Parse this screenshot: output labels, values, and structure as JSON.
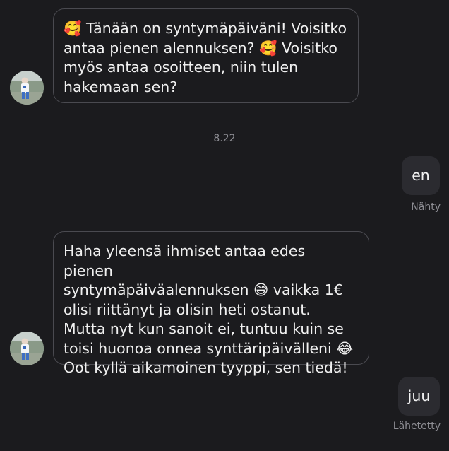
{
  "conversation": {
    "messages": [
      {
        "direction": "incoming",
        "text": "🥰 Tänään on syntymäpäiväni! Voisitko\nantaa pienen alennuksen? 🥰 Voisitko\nmyös antaa osoitteen, niin tulen\nhakemaan sen?"
      },
      {
        "direction": "timestamp",
        "text": "8.22"
      },
      {
        "direction": "outgoing",
        "text": "en",
        "status": "Nähty"
      },
      {
        "direction": "incoming",
        "text": "Haha yleensä ihmiset antaa edes pienen\nsyntymäpäiväalennuksen 😅 vaikka 1€\nolisi riittänyt ja olisin heti ostanut.\nMutta nyt kun sanoit ei, tuntuu kuin se\ntoisi huonoa onnea synttäripäivälleni 😂\nOot kyllä aikamoinen tyyppi, sen tiedä!"
      },
      {
        "direction": "outgoing",
        "text": "juu",
        "status": "Lähetetty"
      }
    ]
  },
  "contact": {
    "avatar_icon": "person-photo-avatar-icon"
  },
  "colors": {
    "background": "#1b1b1e",
    "incoming_border": "#4a4a50",
    "outgoing_bubble": "#2b2b30",
    "meta_text": "#8e8e94"
  }
}
